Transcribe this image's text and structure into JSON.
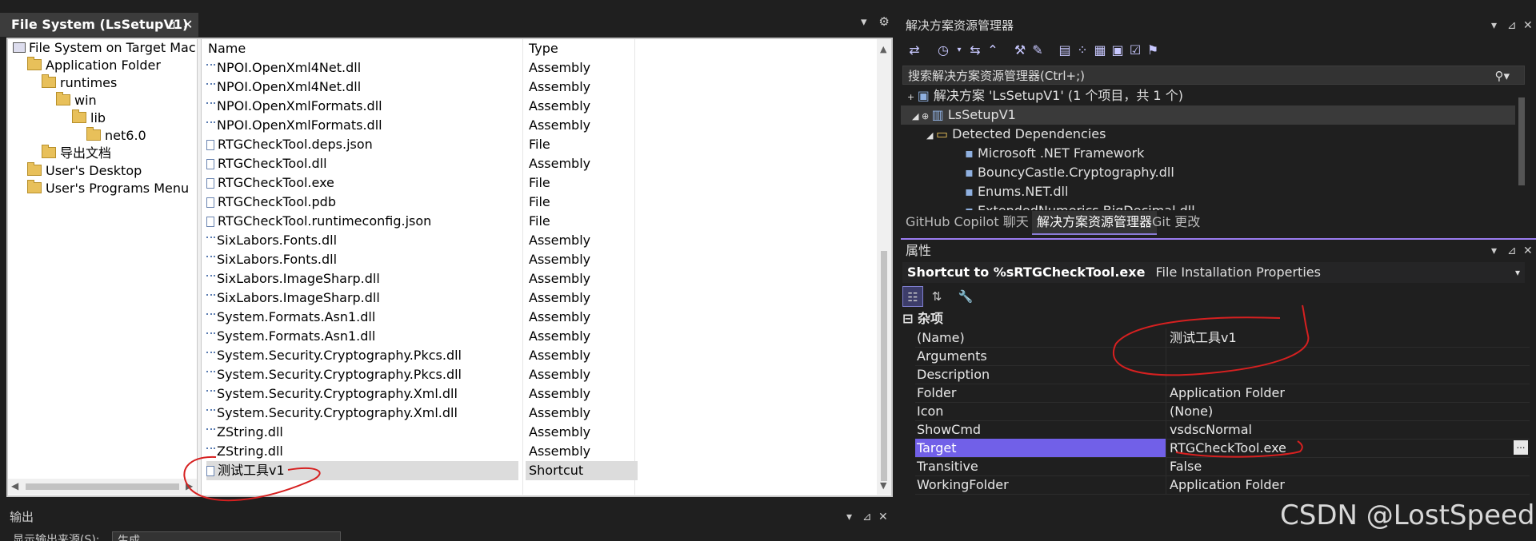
{
  "file_system": {
    "title": "File System (LsSetupV1)",
    "pin": "ᵖ",
    "close": "✕",
    "tree": [
      {
        "label": "File System on Target Machin",
        "kind": "pc"
      },
      {
        "label": "Application Folder",
        "kind": "folder"
      },
      {
        "label": "runtimes",
        "kind": "folder"
      },
      {
        "label": "win",
        "kind": "folder"
      },
      {
        "label": "lib",
        "kind": "folder"
      },
      {
        "label": "net6.0",
        "kind": "folder"
      },
      {
        "label": "导出文档",
        "kind": "folder"
      },
      {
        "label": "User's Desktop",
        "kind": "folder"
      },
      {
        "label": "User's Programs Menu",
        "kind": "folder"
      }
    ],
    "columns": {
      "name": "Name",
      "type": "Type"
    },
    "files": [
      {
        "name": "NPOI.OpenXml4Net.dll",
        "type": "Assembly",
        "icon": "dll"
      },
      {
        "name": "NPOI.OpenXml4Net.dll",
        "type": "Assembly",
        "icon": "dll"
      },
      {
        "name": "NPOI.OpenXmlFormats.dll",
        "type": "Assembly",
        "icon": "dll"
      },
      {
        "name": "NPOI.OpenXmlFormats.dll",
        "type": "Assembly",
        "icon": "dll"
      },
      {
        "name": "RTGCheckTool.deps.json",
        "type": "File",
        "icon": "file"
      },
      {
        "name": "RTGCheckTool.dll",
        "type": "Assembly",
        "icon": "file"
      },
      {
        "name": "RTGCheckTool.exe",
        "type": "File",
        "icon": "file"
      },
      {
        "name": "RTGCheckTool.pdb",
        "type": "File",
        "icon": "file"
      },
      {
        "name": "RTGCheckTool.runtimeconfig.json",
        "type": "File",
        "icon": "file"
      },
      {
        "name": "SixLabors.Fonts.dll",
        "type": "Assembly",
        "icon": "dll"
      },
      {
        "name": "SixLabors.Fonts.dll",
        "type": "Assembly",
        "icon": "dll"
      },
      {
        "name": "SixLabors.ImageSharp.dll",
        "type": "Assembly",
        "icon": "dll"
      },
      {
        "name": "SixLabors.ImageSharp.dll",
        "type": "Assembly",
        "icon": "dll"
      },
      {
        "name": "System.Formats.Asn1.dll",
        "type": "Assembly",
        "icon": "dll"
      },
      {
        "name": "System.Formats.Asn1.dll",
        "type": "Assembly",
        "icon": "dll"
      },
      {
        "name": "System.Security.Cryptography.Pkcs.dll",
        "type": "Assembly",
        "icon": "dll"
      },
      {
        "name": "System.Security.Cryptography.Pkcs.dll",
        "type": "Assembly",
        "icon": "dll"
      },
      {
        "name": "System.Security.Cryptography.Xml.dll",
        "type": "Assembly",
        "icon": "dll"
      },
      {
        "name": "System.Security.Cryptography.Xml.dll",
        "type": "Assembly",
        "icon": "dll"
      },
      {
        "name": "ZString.dll",
        "type": "Assembly",
        "icon": "dll"
      },
      {
        "name": "ZString.dll",
        "type": "Assembly",
        "icon": "dll"
      },
      {
        "name": "测试工具v1",
        "type": "Shortcut",
        "icon": "file",
        "selected": true
      }
    ]
  },
  "output": {
    "title": "输出",
    "source_label": "显示输出来源(S):",
    "source_value": "生成"
  },
  "solution_explorer": {
    "title": "解决方案资源管理器",
    "search_placeholder": "搜索解决方案资源管理器(Ctrl+;)",
    "tree": [
      {
        "label": "解决方案 'LsSetupV1' (1 个项目，共 1 个)",
        "prefix": "+"
      },
      {
        "label": "LsSetupV1",
        "prefix": "◢ ⊕"
      },
      {
        "label": "Detected Dependencies",
        "prefix": "◢"
      },
      {
        "label": "Microsoft .NET Framework",
        "prefix": ""
      },
      {
        "label": "BouncyCastle.Cryptography.dll",
        "prefix": ""
      },
      {
        "label": "Enums.NET.dll",
        "prefix": ""
      },
      {
        "label": "ExtendedNumerics.BigDecimal.dll",
        "prefix": ""
      }
    ],
    "tabs": [
      "GitHub Copilot 聊天",
      "解决方案资源管理器",
      "Git 更改"
    ]
  },
  "properties": {
    "title": "属性",
    "object_name": "Shortcut to %sRTGCheckTool.exe",
    "object_kind": "File Installation Properties",
    "category": "杂项",
    "rows": [
      {
        "name": "(Name)",
        "value": "测试工具v1"
      },
      {
        "name": "Arguments",
        "value": ""
      },
      {
        "name": "Description",
        "value": ""
      },
      {
        "name": "Folder",
        "value": "Application Folder"
      },
      {
        "name": "Icon",
        "value": "(None)"
      },
      {
        "name": "ShowCmd",
        "value": "vsdscNormal"
      },
      {
        "name": "Target",
        "value": "RTGCheckTool.exe",
        "selected": true
      },
      {
        "name": "Transitive",
        "value": "False"
      },
      {
        "name": "WorkingFolder",
        "value": "Application Folder"
      }
    ]
  },
  "watermark": "CSDN @LostSpeed",
  "colors": {
    "accent": "#7160e8",
    "annotation": "#d62020"
  }
}
